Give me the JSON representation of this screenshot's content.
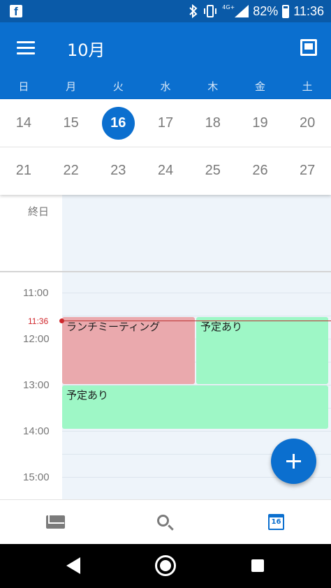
{
  "status_bar": {
    "network": "4G+",
    "battery": "82%",
    "time": "11:36",
    "icons": [
      "facebook-icon",
      "bluetooth-icon",
      "vibrate-icon",
      "signal-icon",
      "battery-icon"
    ]
  },
  "header": {
    "title": "10月"
  },
  "weekdays": [
    "日",
    "月",
    "火",
    "水",
    "木",
    "金",
    "土"
  ],
  "weeks": [
    [
      "14",
      "15",
      "16",
      "17",
      "18",
      "19",
      "20"
    ],
    [
      "21",
      "22",
      "23",
      "24",
      "25",
      "26",
      "27"
    ]
  ],
  "selected_date": "16",
  "all_day": {
    "label": "終日"
  },
  "timeline": {
    "hours": [
      "11:00",
      "12:00",
      "13:00",
      "14:00",
      "15:00"
    ],
    "now_label": "11:36",
    "events": [
      {
        "title": "ランチミーティング",
        "color": "#eaa9ad"
      },
      {
        "title": "予定あり",
        "color": "#9ef7c6"
      },
      {
        "title": "予定あり",
        "color": "#9ef7c6"
      }
    ]
  },
  "bottom_nav": {
    "items": [
      "mail-icon",
      "search-icon",
      "calendar-icon"
    ],
    "calendar_day": "16"
  },
  "colors": {
    "accent": "#0b6fcf",
    "status_bar": "#0a5aa8",
    "now_indicator": "#d0262b"
  }
}
